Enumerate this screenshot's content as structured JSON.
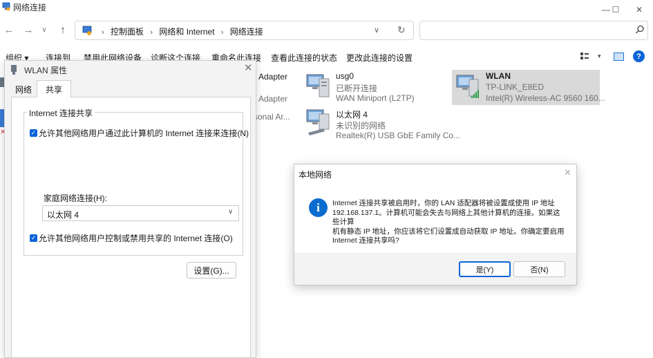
{
  "window": {
    "title": "网络连接",
    "controls": {
      "minimize": "—",
      "maximize": "☐",
      "close": "✕"
    }
  },
  "nav": {
    "back": "←",
    "forward": "→",
    "recent": "∨",
    "up": "↑",
    "breadcrumb": [
      "控制面板",
      "网络和 Internet",
      "网络连接"
    ],
    "breadcrumb_separator": "›",
    "dropdown": "∨",
    "refresh": "↻",
    "search_placeholder": ""
  },
  "commandbar": {
    "items": [
      "组织 ▾",
      "连接到",
      "禁用此网络设备",
      "诊断这个连接",
      "重命名此连接",
      "查看此连接的状态",
      "更改此连接的设置"
    ],
    "view_dropdown": "▾",
    "help": "?"
  },
  "connections": [
    {
      "name": "",
      "status": "",
      "device": "Adapter"
    },
    {
      "name": "",
      "status": "",
      "device": "Adapter"
    },
    {
      "name": "",
      "status": "",
      "device": "rsonal Ar..."
    },
    {
      "name": "usg0",
      "status": "已断开连接",
      "device": "WAN Miniport (L2TP)"
    },
    {
      "name": "以太网 4",
      "status": "未识别的网络",
      "device": "Realtek(R) USB GbE Family Co..."
    },
    {
      "name": "WLAN",
      "status": "TP-LINK_E8ED",
      "device": "Intel(R) Wireless-AC 9560 160..."
    }
  ],
  "properties_dialog": {
    "title": "WLAN 属性",
    "close": "✕",
    "tabs": [
      "网络",
      "共享"
    ],
    "active_tab": "共享",
    "group_title": "Internet 连接共享",
    "allow_connect_label": "允许其他网络用户通过此计算机的 Internet 连接来连接(N)",
    "allow_connect_checked": true,
    "home_network_label": "家庭网络连接(H):",
    "home_network_value": "以太网 4",
    "allow_control_label": "允许其他网络用户控制或禁用共享的 Internet 连接(O)",
    "allow_control_checked": true,
    "settings_button": "设置(G)..."
  },
  "message_box": {
    "title": "本地网络",
    "close": "✕",
    "icon": "i",
    "lines": [
      "Internet 连接共享被启用时，你的 LAN 适配器将被设置成使用 IP 地址",
      "192.168.137.1。计算机可能会失去与网络上其他计算机的连接。如果这些计算",
      "机有静态 IP 地址，你应该将它们设置成自动获取 IP 地址。你确定要启用",
      "Internet 连接共享吗?"
    ],
    "yes_button": "是(Y)",
    "no_button": "否(N)"
  },
  "colors": {
    "accent": "#0a64d8",
    "selection": "#d9d9d9",
    "dialog_bg": "#f3f3f3"
  }
}
